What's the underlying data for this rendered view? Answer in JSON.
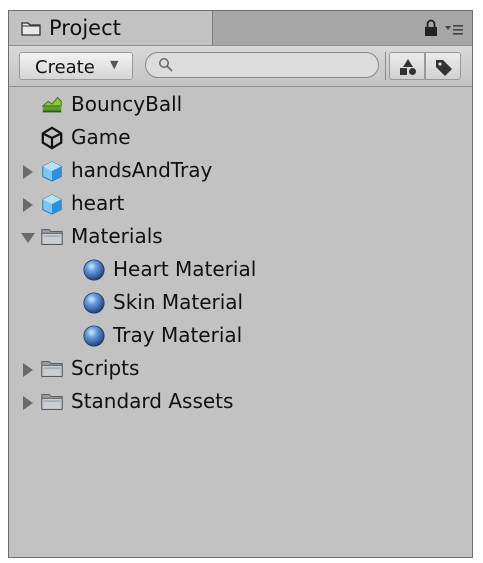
{
  "window": {
    "tab_title": "Project",
    "tab_icon": "folder-icon"
  },
  "toolbar": {
    "create_label": "Create",
    "create_arrow": "▼",
    "search_value": "",
    "search_placeholder": ""
  },
  "tree": {
    "items": [
      {
        "label": "BouncyBall",
        "icon": "terrain-icon",
        "expandable": false,
        "expanded": false,
        "indent": 0
      },
      {
        "label": "Game",
        "icon": "unity-scene-icon",
        "expandable": false,
        "expanded": false,
        "indent": 0
      },
      {
        "label": "handsAndTray",
        "icon": "model-prefab-icon",
        "expandable": true,
        "expanded": false,
        "indent": 0
      },
      {
        "label": "heart",
        "icon": "model-prefab-icon",
        "expandable": true,
        "expanded": false,
        "indent": 0
      },
      {
        "label": "Materials",
        "icon": "folder-icon",
        "expandable": true,
        "expanded": true,
        "indent": 0
      },
      {
        "label": "Heart Material",
        "icon": "material-sphere-icon",
        "expandable": false,
        "expanded": false,
        "indent": 1
      },
      {
        "label": "Skin Material",
        "icon": "material-sphere-icon",
        "expandable": false,
        "expanded": false,
        "indent": 1
      },
      {
        "label": "Tray Material",
        "icon": "material-sphere-icon",
        "expandable": false,
        "expanded": false,
        "indent": 1
      },
      {
        "label": "Scripts",
        "icon": "folder-icon",
        "expandable": true,
        "expanded": false,
        "indent": 0
      },
      {
        "label": "Standard Assets",
        "icon": "folder-icon",
        "expandable": true,
        "expanded": false,
        "indent": 0
      }
    ]
  },
  "colors": {
    "panel_bg": "#c2c2c2",
    "tabbar_bg": "#a6a6a6",
    "material_blue": "#4a7fc4",
    "prefab_blue": "#3a9be0"
  }
}
